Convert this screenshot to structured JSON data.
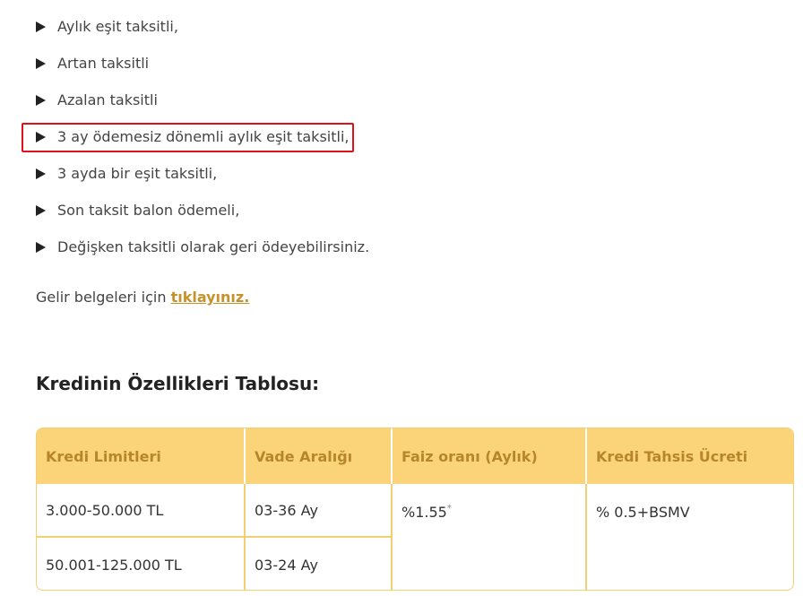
{
  "bullets": [
    "Aylık eşit taksitli,",
    "Artan taksitli",
    "Azalan taksitli",
    "3 ay ödemesiz dönemli aylık eşit taksitli,",
    "3 ayda bir eşit taksitli,",
    "Son taksit balon ödemeli,",
    "Değişken taksitli olarak geri ödeyebilirsiniz."
  ],
  "gelir": {
    "text": "Gelir belgeleri için ",
    "link": "tıklayınız."
  },
  "section_title": "Kredinin Özellikleri Tablosu:",
  "table": {
    "headers": [
      "Kredi Limitleri",
      "Vade Aralığı",
      "Faiz oranı (Aylık)",
      "Kredi Tahsis Ücreti"
    ],
    "rows": [
      {
        "limit": "3.000-50.000 TL",
        "vade": "03-36 Ay"
      },
      {
        "limit": "50.001-125.000 TL",
        "vade": "03-24 Ay"
      }
    ],
    "faiz": "%1.55",
    "faiz_note": "*",
    "ucret": "% 0.5+BSMV"
  },
  "colors": {
    "accent": "#c8922a",
    "header_bg": "#fbd47a",
    "highlight": "#e0101a"
  }
}
